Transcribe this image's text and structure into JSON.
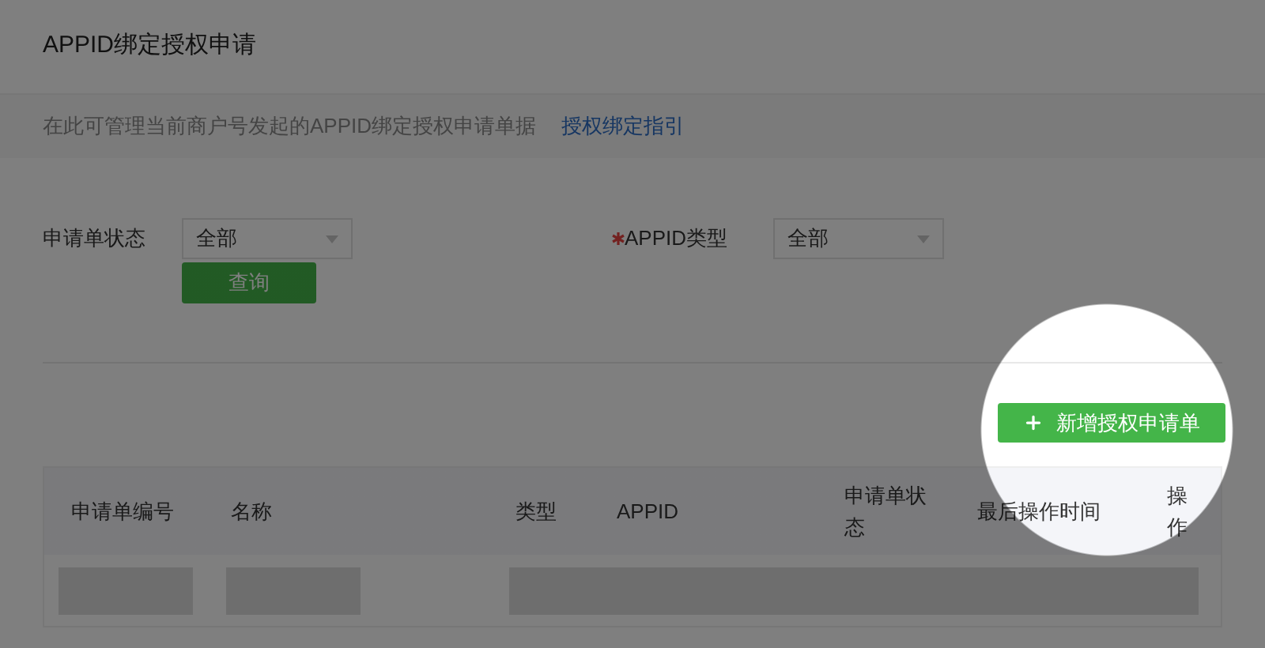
{
  "page": {
    "title": "APPID绑定授权申请"
  },
  "notice": {
    "text": "在此可管理当前商户号发起的APPID绑定授权申请单据",
    "link": "授权绑定指引"
  },
  "filters": [
    {
      "label": "申请单状态",
      "required": false,
      "value": "全部"
    },
    {
      "label": "APPID类型",
      "required": true,
      "value": "全部"
    }
  ],
  "query_button": "查询",
  "add_button": {
    "label": "新增授权申请单"
  },
  "table": {
    "columns": [
      "申请单编号",
      "名称",
      "类型",
      "APPID",
      "申请单状态",
      "最后操作时间",
      "操作"
    ],
    "loading": true
  },
  "spotlight": {
    "on": true
  }
}
